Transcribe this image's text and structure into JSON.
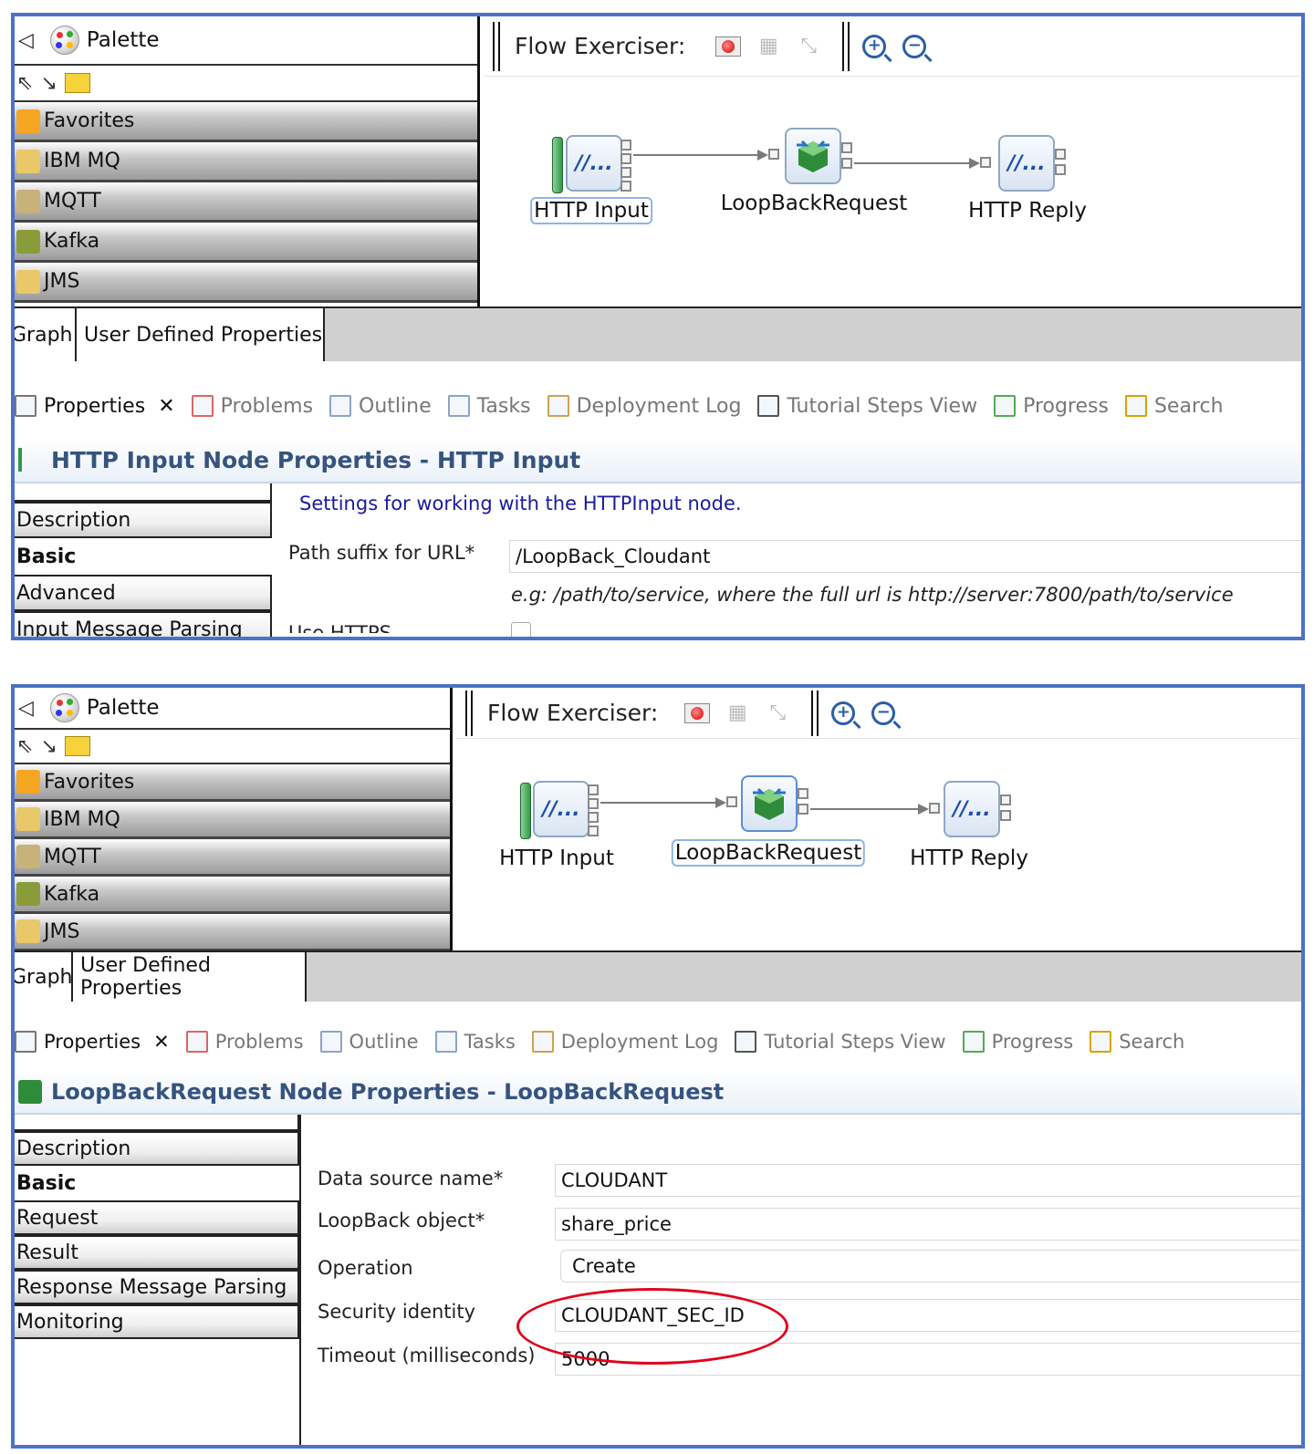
{
  "colors": {
    "accent_border": "#4a72c7",
    "highlight_circle": "#e0001b",
    "settings_text": "#1a1aa0",
    "props_title": "#35547f"
  },
  "palette": {
    "title": "Palette",
    "back_icon": "collapse-left-icon",
    "drawers": [
      {
        "label": "Favorites",
        "icon": "favorites-folder-icon"
      },
      {
        "label": "IBM MQ",
        "icon": "mq-folder-icon"
      },
      {
        "label": "MQTT",
        "icon": "mqtt-folder-icon"
      },
      {
        "label": "Kafka",
        "icon": "kafka-folder-icon"
      },
      {
        "label": "JMS",
        "icon": "jms-folder-icon"
      }
    ]
  },
  "toolbar": {
    "flow_exerciser_label": "Flow Exerciser:"
  },
  "flow": {
    "nodes": [
      {
        "label": "HTTP Input",
        "glyph": "//..."
      },
      {
        "label": "LoopBackRequest",
        "glyph": ""
      },
      {
        "label": "HTTP Reply",
        "glyph": "//..."
      }
    ]
  },
  "editor_tabs": [
    "Graph",
    "User Defined Properties"
  ],
  "views": [
    {
      "label": "Properties",
      "icon": "properties-icon",
      "close": "✕"
    },
    {
      "label": "Problems",
      "icon": "problems-icon"
    },
    {
      "label": "Outline",
      "icon": "outline-icon"
    },
    {
      "label": "Tasks",
      "icon": "tasks-icon"
    },
    {
      "label": "Deployment Log",
      "icon": "deployment-log-icon"
    },
    {
      "label": "Tutorial Steps View",
      "icon": "book-icon"
    },
    {
      "label": "Progress",
      "icon": "progress-icon"
    },
    {
      "label": "Search",
      "icon": "search-flashlight-icon"
    }
  ],
  "shot1": {
    "props_title": "HTTP Input Node Properties - HTTP Input",
    "sidetabs": [
      "Description",
      "Basic",
      "Advanced",
      "Input Message Parsing"
    ],
    "settings_text": "Settings for working with the HTTPInput node.",
    "path_label": "Path suffix for URL*",
    "path_value": "/LoopBack_Cloudant",
    "path_hint": "e.g: /path/to/service, where the full url is http://server:7800/path/to/service",
    "https_label": "Use HTTPS"
  },
  "shot2": {
    "props_title": "LoopBackRequest Node Properties - LoopBackRequest",
    "sidetabs": [
      "Description",
      "Basic",
      "Request",
      "Result",
      "Response Message Parsing",
      "Monitoring"
    ],
    "fields": [
      {
        "label": "Data source name*",
        "value": "CLOUDANT"
      },
      {
        "label": "LoopBack object*",
        "value": "share_price"
      },
      {
        "label": "Operation",
        "value": "Create"
      },
      {
        "label": "Security identity",
        "value": "CLOUDANT_SEC_ID"
      },
      {
        "label": "Timeout (milliseconds)",
        "value": "5000"
      }
    ]
  }
}
